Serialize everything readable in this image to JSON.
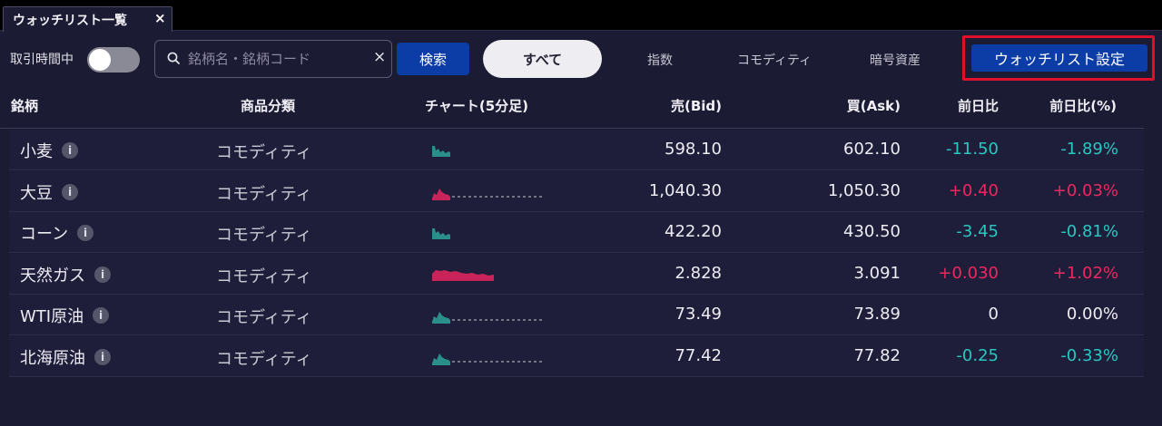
{
  "tab": {
    "title": "ウォッチリスト一覧",
    "close_glyph": "×"
  },
  "toolbar": {
    "market_hours_label": "取引時間中",
    "toggle_on": false,
    "search_placeholder": "銘柄名・銘柄コード",
    "search_value": "",
    "clear_glyph": "×",
    "search_button": "検索",
    "filters": [
      "すべて",
      "指数",
      "コモディティ",
      "暗号資産"
    ],
    "active_filter": "すべて",
    "settings_button": "ウォッチリスト設定"
  },
  "table": {
    "headers": {
      "name": "銘柄",
      "category": "商品分類",
      "chart": "チャート(5分足)",
      "bid": "売(Bid)",
      "ask": "買(Ask)",
      "change": "前日比",
      "change_pct": "前日比(%)"
    },
    "rows": [
      {
        "name": "小麦",
        "category": "コモディティ",
        "bid": "598.10",
        "ask": "602.10",
        "change": "-11.50",
        "change_pct": "-1.89%",
        "trend": "neg",
        "spark": "short"
      },
      {
        "name": "大豆",
        "category": "コモディティ",
        "bid": "1,040.30",
        "ask": "1,050.30",
        "change": "+0.40",
        "change_pct": "+0.03%",
        "trend": "pos",
        "spark": "dashed"
      },
      {
        "name": "コーン",
        "category": "コモディティ",
        "bid": "422.20",
        "ask": "430.50",
        "change": "-3.45",
        "change_pct": "-0.81%",
        "trend": "neg",
        "spark": "short"
      },
      {
        "name": "天然ガス",
        "category": "コモディティ",
        "bid": "2.828",
        "ask": "3.091",
        "change": "+0.030",
        "change_pct": "+1.02%",
        "trend": "pos",
        "spark": "full"
      },
      {
        "name": "WTI原油",
        "category": "コモディティ",
        "bid": "73.49",
        "ask": "73.89",
        "change": "0",
        "change_pct": "0.00%",
        "trend": "neu",
        "spark": "dashed"
      },
      {
        "name": "北海原油",
        "category": "コモディティ",
        "bid": "77.42",
        "ask": "77.82",
        "change": "-0.25",
        "change_pct": "-0.33%",
        "trend": "neg",
        "spark": "dashed"
      }
    ]
  },
  "colors": {
    "background": "#1c1b34",
    "accent_blue": "#0c3da6",
    "highlight_red": "#e0102c",
    "negative_teal": "#28c8c0",
    "positive_pink": "#f0265e"
  },
  "icons": [
    "search-icon",
    "clear-icon",
    "info-icon",
    "close-icon"
  ]
}
